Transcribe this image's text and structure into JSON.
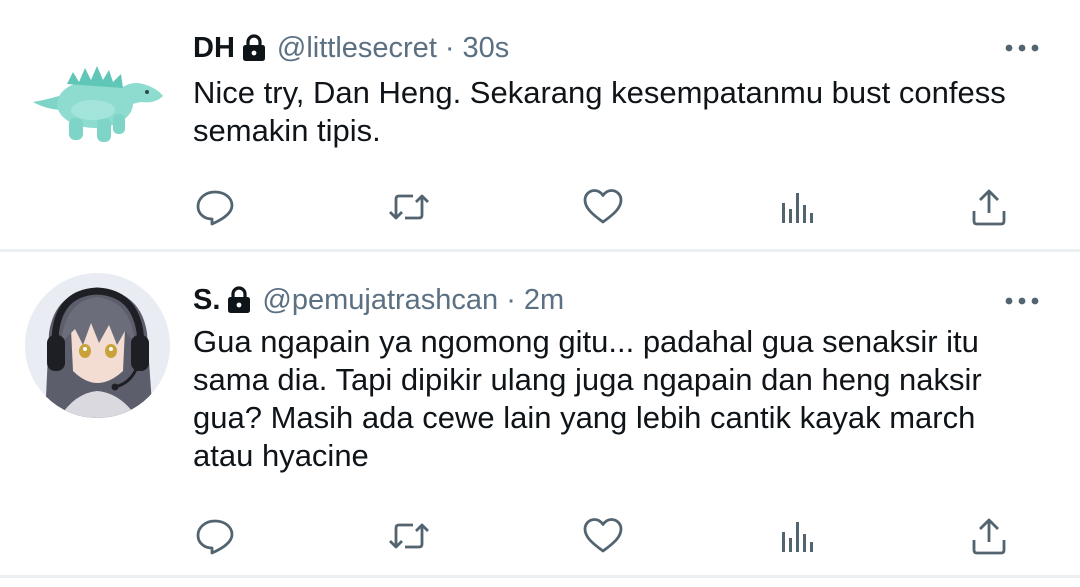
{
  "tweets": [
    {
      "name": "DH",
      "handle": "@littlesecret",
      "separator": "·",
      "time": "30s",
      "text": "Nice try, Dan Heng. Sekarang kesempatanmu bust confess semakin tipis.",
      "avatar": "plush-dinosaur-avatar",
      "locked": true
    },
    {
      "name": "S.",
      "handle": "@pemujatrashcan",
      "separator": "·",
      "time": "2m",
      "text": "Gua ngapain ya ngomong gitu... padahal gua senaksir itu sama dia. Tapi dipikir ulang juga ngapain dan heng naksir gua? Masih ada cewe lain yang lebih cantik kayak march atau hyacine",
      "avatar": "anime-girl-headset-avatar",
      "locked": true
    }
  ],
  "icons": {
    "lock": "lock-icon",
    "more": "more-options-icon",
    "reply": "reply-icon",
    "retweet": "retweet-icon",
    "like": "heart-icon",
    "views": "analytics-icon",
    "share": "share-icon"
  },
  "colors": {
    "text": "#0f1419",
    "secondary": "#5b7083",
    "icon": "#536471",
    "divider": "#eceff1"
  }
}
